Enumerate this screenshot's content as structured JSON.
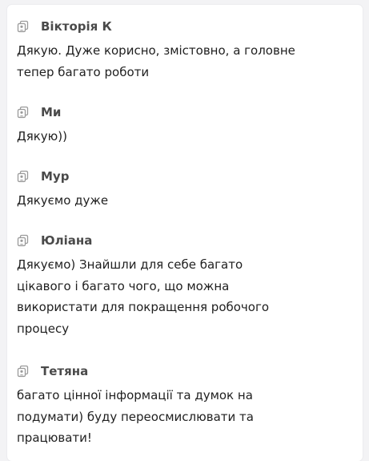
{
  "comments": [
    {
      "author": "Вікторія К",
      "text": "Дякую. Дуже корисно, змістовно, а головне\nтепер багато роботи"
    },
    {
      "author": "Ми",
      "text": "Дякую))"
    },
    {
      "author": "Мур",
      "text": "Дякуємо дуже"
    },
    {
      "author": "Юліана",
      "text": "Дякуємо) Знайшли для себе багато\nцікавого і багато чого, що можна\nвикористати для покращення робочого\nпроцесу"
    },
    {
      "author": "Тетяна",
      "text": "багато цінної інформації та думок на\nподумати) буду переосмислювати та\nпрацювати!"
    }
  ]
}
